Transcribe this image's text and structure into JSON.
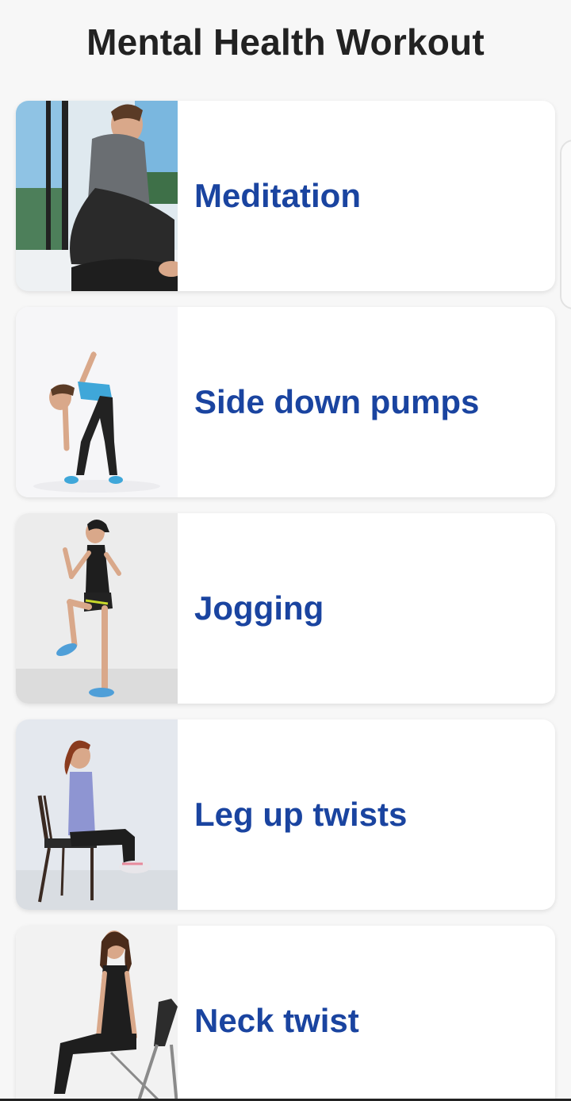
{
  "header": {
    "title": "Mental Health Workout"
  },
  "exercises": [
    {
      "label": "Meditation"
    },
    {
      "label": "Side down pumps"
    },
    {
      "label": "Jogging"
    },
    {
      "label": "Leg up twists"
    },
    {
      "label": "Neck twist"
    }
  ],
  "colors": {
    "background": "#f7f7f7",
    "card": "#ffffff",
    "label": "#1a44a0",
    "title": "#222222"
  }
}
